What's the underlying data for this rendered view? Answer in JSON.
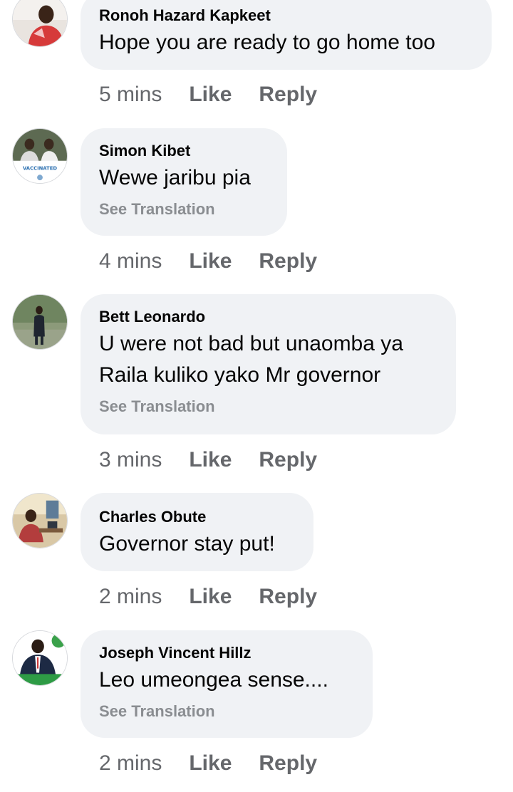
{
  "comments": [
    {
      "author": "Ronoh Hazard Kapkeet",
      "text": "Hope you are ready to go home too",
      "time": "5 mins",
      "like": "Like",
      "reply": "Reply"
    },
    {
      "author": "Simon Kibet",
      "text": "Wewe jaribu pia",
      "see_translation": "See Translation",
      "avatar_badge": "VACCINATED",
      "time": "4 mins",
      "like": "Like",
      "reply": "Reply"
    },
    {
      "author": "Bett Leonardo",
      "text_lines": [
        "U were not bad but unaomba ya",
        "Raila kuliko yako Mr governor"
      ],
      "see_translation": "See Translation",
      "time": "3 mins",
      "like": "Like",
      "reply": "Reply"
    },
    {
      "author": "Charles Obute",
      "text": "Governor stay put!",
      "time": "2 mins",
      "like": "Like",
      "reply": "Reply"
    },
    {
      "author": "Joseph Vincent Hillz",
      "text": "Leo umeongea sense....",
      "see_translation": "See Translation",
      "time": "2 mins",
      "like": "Like",
      "reply": "Reply"
    }
  ],
  "colors": {
    "bubble_bg": "#f0f2f5",
    "author_text": "#050505",
    "secondary_text": "#65676b",
    "translation_text": "#8a8d91"
  }
}
